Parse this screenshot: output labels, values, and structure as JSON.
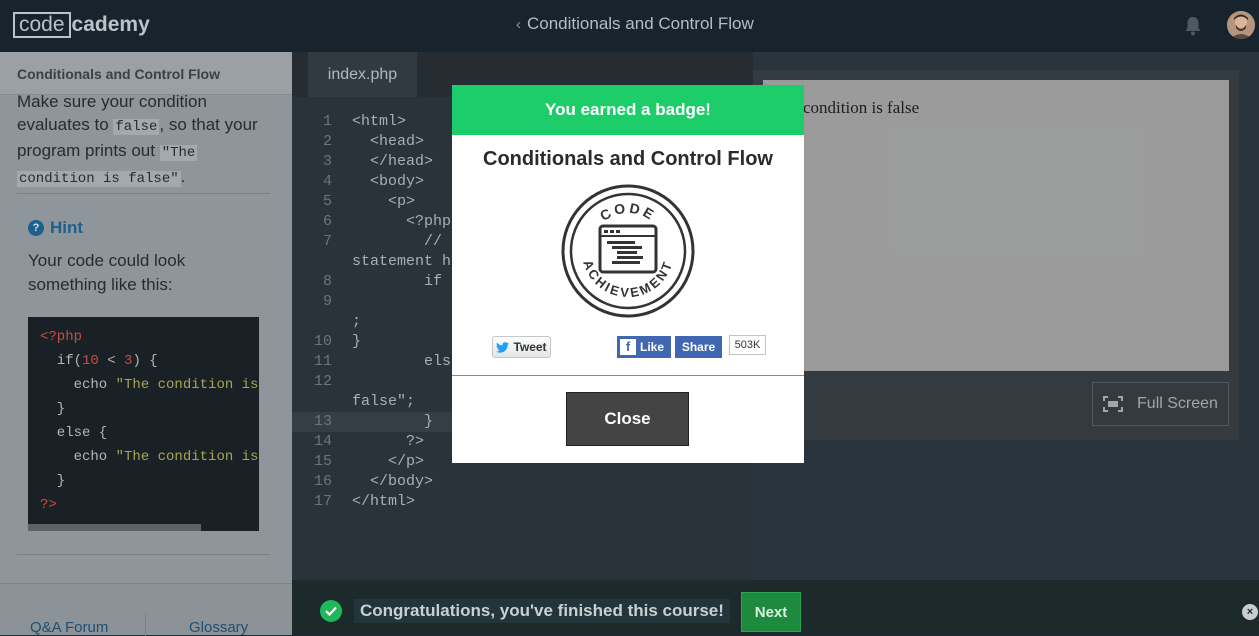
{
  "topbar": {
    "logo_boxed": "code",
    "logo_rest": "cademy",
    "back_chevron": "‹",
    "course_title": "Conditionals and Control Flow",
    "bell_icon": "bell-icon",
    "avatar_icon": "user-avatar"
  },
  "instructions": {
    "header": "Conditionals and Control Flow",
    "line1": "Make sure your condition",
    "line2_pre": "evaluates to ",
    "line2_code": "false",
    "line2_post": ", so that your",
    "line3_pre": "program prints out ",
    "line3_code": "\"The",
    "line4_code": "condition is false\"",
    "line4_post": ".",
    "hint_icon": "?",
    "hint_label": "Hint",
    "hint_text": "Your code could look something like this:",
    "snippet": [
      "<?php",
      "  if(10 < 3) {",
      "    echo \"The condition is",
      "  }",
      "  else {",
      "    echo \"The condition is",
      "  }",
      "?>"
    ],
    "footer_qa": "Q&A Forum",
    "footer_glossary": "Glossary"
  },
  "editor": {
    "tab": "index.php",
    "lines": [
      {
        "n": "1",
        "t": "<html>"
      },
      {
        "n": "2",
        "t": "  <head>"
      },
      {
        "n": "3",
        "t": "  </head>"
      },
      {
        "n": "4",
        "t": "  <body>"
      },
      {
        "n": "5",
        "t": "    <p>"
      },
      {
        "n": "6",
        "t": "      <?php"
      },
      {
        "n": "7",
        "t": "        //"
      },
      {
        "n": "",
        "t": "statement h"
      },
      {
        "n": "8",
        "t": "        if"
      },
      {
        "n": "9",
        "t": "        "
      },
      {
        "n": "",
        "t": ";"
      },
      {
        "n": "10",
        "t": "}"
      },
      {
        "n": "11",
        "t": "        els"
      },
      {
        "n": "12",
        "t": "        "
      },
      {
        "n": "",
        "t": "false\";"
      },
      {
        "n": "13",
        "t": "        }"
      },
      {
        "n": "14",
        "t": "      ?>"
      },
      {
        "n": "15",
        "t": "    </p>"
      },
      {
        "n": "16",
        "t": "  </body>"
      },
      {
        "n": "17",
        "t": "</html>"
      }
    ]
  },
  "preview": {
    "output": "condition is false",
    "fullscreen_label": "Full Screen"
  },
  "modal": {
    "header": "You earned a badge!",
    "title": "Conditionals and Control Flow",
    "badge_top": "CODE",
    "badge_bottom": "ACHIEVEMENT",
    "tweet": "Tweet",
    "like": "Like",
    "share": "Share",
    "count": "503K",
    "close": "Close"
  },
  "bottom": {
    "congrats": "Congratulations, you've finished this course!",
    "next": "Next",
    "dismiss": "×"
  },
  "colors": {
    "accent_green": "#1dcd6a",
    "next_green": "#1d8a3e",
    "facebook": "#4267b2",
    "hint_blue": "#1f5f8c"
  }
}
